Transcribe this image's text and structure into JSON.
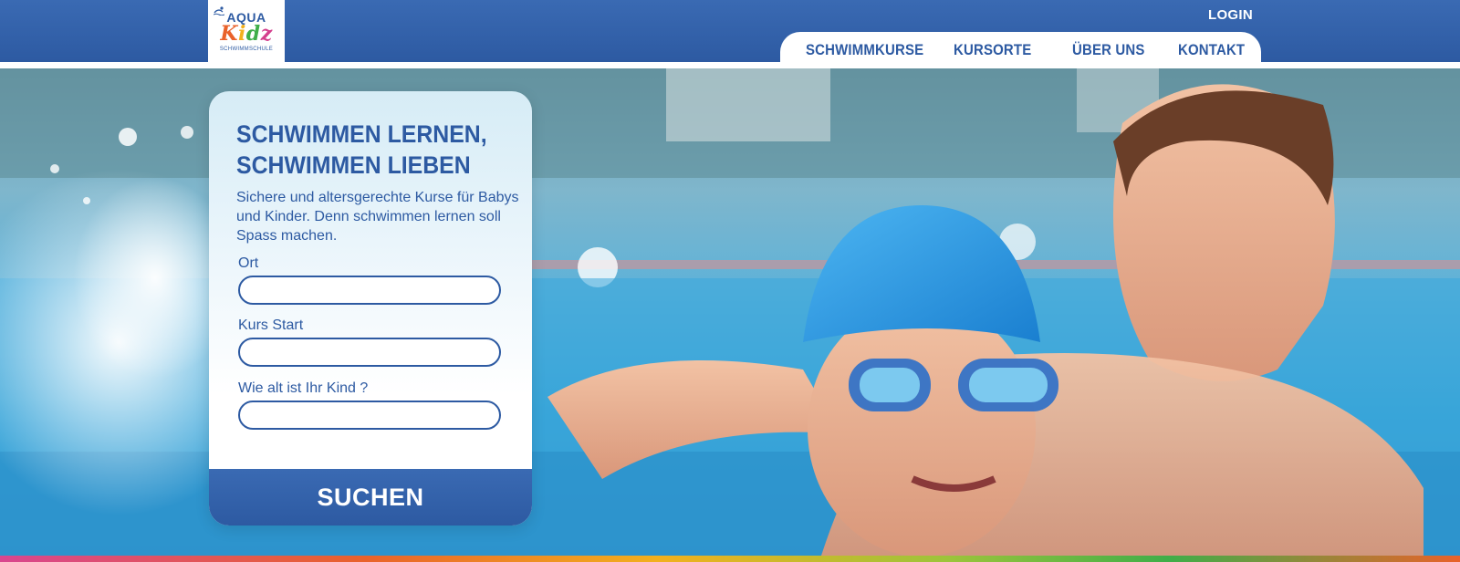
{
  "colors": {
    "brand_blue": "#2d5aa2",
    "header_blue": "#3a6ab3",
    "white": "#ffffff",
    "logo_orange": "#e9622a",
    "logo_yellow": "#f2b01e",
    "logo_green": "#3fae49",
    "logo_pink": "#d43f8d"
  },
  "logo": {
    "top": "AQUA",
    "kidz": [
      "K",
      "i",
      "d",
      "z"
    ],
    "sub": "SCHWIMMSCHULE",
    "icon": "swimmer-icon"
  },
  "header": {
    "login": "LOGIN"
  },
  "nav": {
    "items": [
      {
        "label": "SCHWIMMKURSE"
      },
      {
        "label": "KURSORTE"
      },
      {
        "label": "ÜBER UNS"
      },
      {
        "label": "KONTAKT"
      }
    ]
  },
  "hero": {
    "title_line1": "SCHWIMMEN LERNEN,",
    "title_line2": "SCHWIMMEN LIEBEN",
    "subtitle": "Sichere und altersgerechte Kurse für Babys und Kinder. Denn schwimmen lernen soll Spass machen."
  },
  "search_form": {
    "fields": [
      {
        "label": "Ort",
        "value": "",
        "placeholder": ""
      },
      {
        "label": "Kurs Start",
        "value": "",
        "placeholder": ""
      },
      {
        "label": "Wie alt ist Ihr Kind ?",
        "value": "",
        "placeholder": ""
      }
    ],
    "submit": "SUCHEN"
  }
}
